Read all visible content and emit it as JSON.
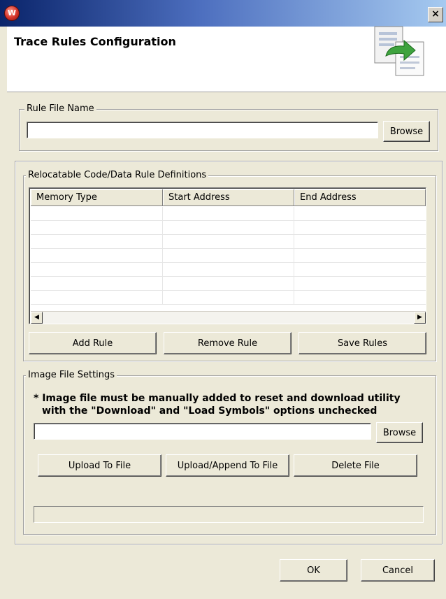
{
  "window": {
    "app_icon_glyph": "W",
    "close_glyph": "×",
    "title": "Trace Rules Configuration",
    "header_icon": "import-rules-icon"
  },
  "rule_file": {
    "legend": "Rule File Name",
    "value": "",
    "browse_label": "Browse"
  },
  "relocatable": {
    "legend": "Relocatable Code/Data Rule Definitions",
    "columns": [
      "Memory Type",
      "Start Address",
      "End Address"
    ],
    "rows": [],
    "scroll_left_glyph": "◀",
    "scroll_right_glyph": "▶",
    "add_label": "Add Rule",
    "remove_label": "Remove Rule",
    "save_label": "Save Rules"
  },
  "image_file": {
    "legend": "Image File Settings",
    "note_line1": "* Image file must be manually added to reset and download utility",
    "note_line2": "with the \"Download\" and \"Load Symbols\" options unchecked",
    "value": "",
    "browse_label": "Browse",
    "upload_label": "Upload To File",
    "upload_append_label": "Upload/Append To File",
    "delete_label": "Delete File",
    "progress": 0
  },
  "footer": {
    "ok_label": "OK",
    "cancel_label": "Cancel"
  }
}
